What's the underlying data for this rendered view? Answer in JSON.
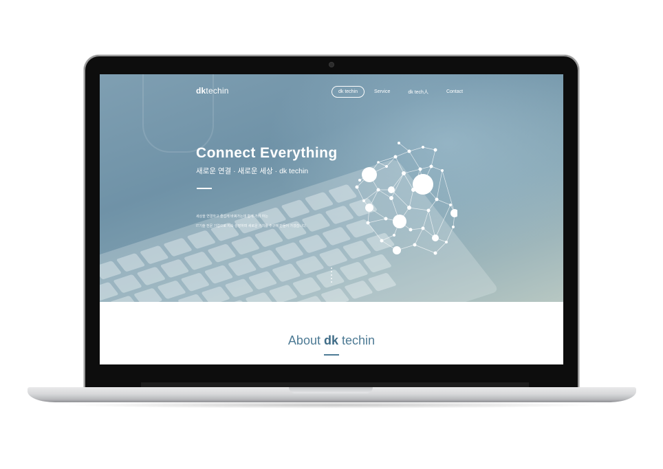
{
  "site": {
    "brand_prefix": "dk",
    "brand_suffix": "techin"
  },
  "nav": {
    "items": [
      {
        "label": "dk techin",
        "active": true
      },
      {
        "label": "Service",
        "active": false
      },
      {
        "label": "dk tech人",
        "active": false
      },
      {
        "label": "Contact",
        "active": false
      }
    ]
  },
  "hero": {
    "title": "Connect  Everything",
    "subtitle": "새로운 연결 · 새로운 세상 · dk techin",
    "description_line1": "세상을 연결하고 즐겁게 바꿔가는데 함께 가려 하는",
    "description_line2": "IT기술 전문 기업으로 지속 성장하며 새로운 가치를 추구해 만들어 가겠습니다."
  },
  "about": {
    "title_prefix": "About",
    "title_brand": "dk",
    "title_suffix": "techin"
  },
  "colors": {
    "hero_gradient": [
      "#7f9fb2",
      "#6f92a7",
      "#86a6b4",
      "#b7c7c2"
    ],
    "accent": "#4d7a94",
    "laptop_bezel": "#0d0d0d",
    "laptop_body": "#d7d8da"
  }
}
